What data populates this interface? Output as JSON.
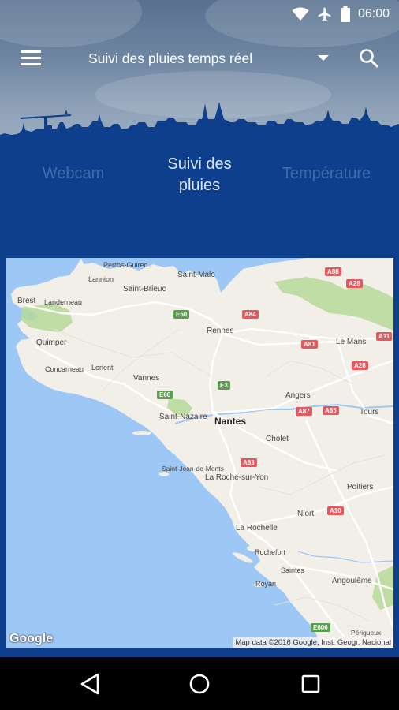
{
  "status": {
    "time": "06:00",
    "battery_label": "100"
  },
  "toolbar": {
    "title": "Suivi des pluies temps réel"
  },
  "tabs": [
    {
      "line1": "Webcam",
      "line2": ""
    },
    {
      "line1": "Suivi des",
      "line2": "pluies"
    },
    {
      "line1": "Température",
      "line2": ""
    }
  ],
  "map": {
    "google_logo": "Google",
    "attribution": "Map data ©2016 Google, Inst. Geogr. Nacional",
    "places": {
      "perros_guirec": "Perros-Guirec",
      "lannion": "Lannion",
      "saint_malo": "Saint-Malo",
      "saint_brieuc": "Saint-Brieuc",
      "brest": "Brest",
      "landerneau": "Landerneau",
      "rennes": "Rennes",
      "quimper": "Quimper",
      "le_mans": "Le Mans",
      "lorient": "Lorient",
      "concarneau": "Concarneau",
      "vannes": "Vannes",
      "angers": "Angers",
      "tours": "Tours",
      "saint_nazaire": "Saint-Nazaire",
      "nantes": "Nantes",
      "cholet": "Cholet",
      "saint_jean_de_monts": "Saint-Jean-de-Monts",
      "la_roche_sur_yon": "La Roche-sur-Yon",
      "poitiers": "Poitiers",
      "niort": "Niort",
      "la_rochelle": "La Rochelle",
      "rochefort": "Rochefort",
      "saintes": "Saintes",
      "royan": "Royan",
      "angouleme": "Angoulême",
      "perigueux": "Périgueux"
    },
    "roads": {
      "a88": "A88",
      "a28_north": "A28",
      "e50": "E50",
      "a84": "A84",
      "a11": "A11",
      "a81": "A81",
      "a28_south": "A28",
      "e3": "E3",
      "e60": "E60",
      "a87": "A87",
      "a85": "A85",
      "a83": "A83",
      "a10": "A10",
      "e606": "E606"
    }
  },
  "colors": {
    "header_blue": "#0e3f8d",
    "inactive_tab": "#3f6aab",
    "active_tab": "#dbe6f7",
    "sea": "#9dc7f5",
    "land": "#f2efe9",
    "road_shield_red": "#e8575c",
    "road_shield_green": "#5a9f4e"
  },
  "nav": {
    "back": "back-icon",
    "home": "home-icon",
    "recents": "recents-icon"
  }
}
